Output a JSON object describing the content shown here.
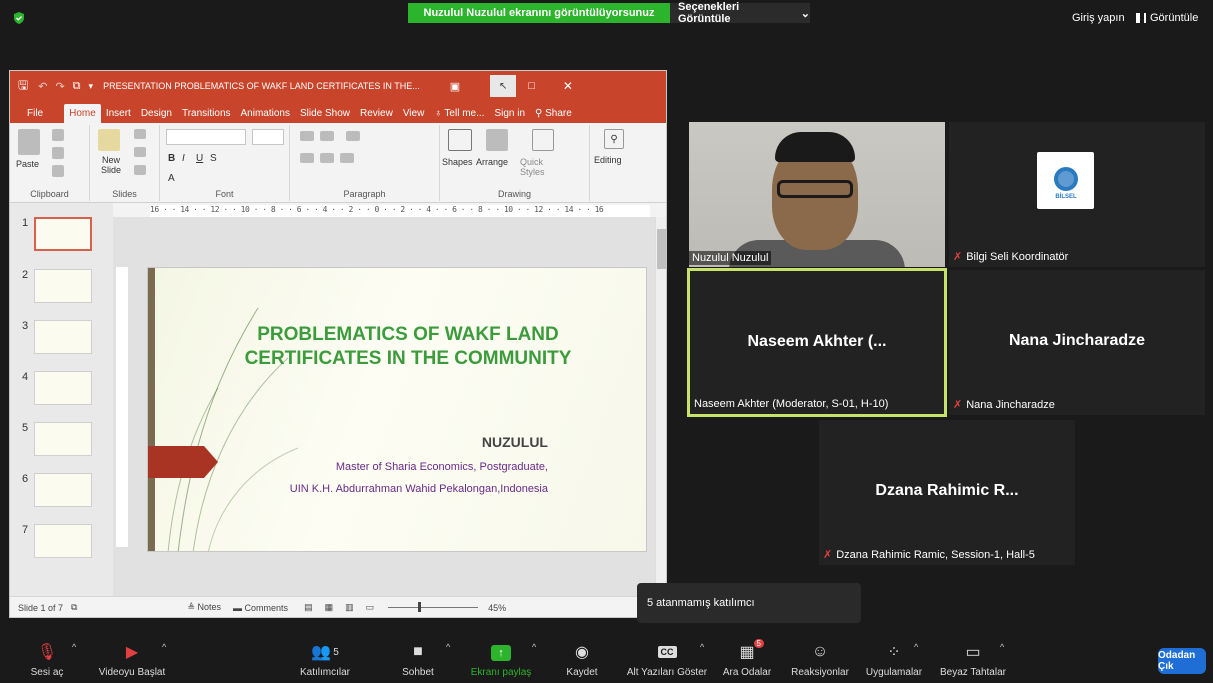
{
  "topbar": {
    "share_banner": "Nuzulul Nuzulul ekranını görüntülüyorsunuz",
    "view_options": "Seçenekleri Görüntüle",
    "sign_in": "Giriş yapın",
    "view": "Görüntüle"
  },
  "ppt": {
    "window_title": "PRESENTATION PROBLEMATICS OF WAKF LAND CERTIFICATES IN THE...",
    "tabs": [
      "File",
      "Home",
      "Insert",
      "Design",
      "Transitions",
      "Animations",
      "Slide Show",
      "Review",
      "View",
      "Tell me...",
      "Sign in",
      "Share"
    ],
    "ribbon": {
      "paste": "Paste",
      "new_slide": "New Slide",
      "shapes": "Shapes",
      "arrange": "Arrange",
      "quick_styles": "Quick Styles",
      "editing": "Editing",
      "groups": [
        "Clipboard",
        "Slides",
        "Font",
        "Paragraph",
        "Drawing"
      ]
    },
    "ruler_text": "16 · · 14 · · 12 · · 10 · · 8 · · 6 · · 4 · · 2 · · 0 · · 2 · · 4 · · 6 · · 8 · · 10 · · 12 · · 14 · · 16",
    "slide_numbers": [
      "1",
      "2",
      "3",
      "4",
      "5",
      "6",
      "7"
    ],
    "slide": {
      "title": "PROBLEMATICS OF WAKF LAND CERTIFICATES IN THE COMMUNITY",
      "author": "NUZULUL",
      "subtitle1": "Master of Sharia Economics, Postgraduate,",
      "subtitle2": "UIN K.H. Abdurrahman Wahid Pekalongan,Indonesia"
    },
    "status": {
      "slide_of": "Slide 1 of 7",
      "notes": "Notes",
      "comments": "Comments",
      "zoom": "45%"
    }
  },
  "participants": [
    {
      "name": "Nuzulul Nuzulul"
    },
    {
      "name": "Bilgi Seli Koordinatör"
    },
    {
      "big": "Naseem Akhter (...",
      "name": "Naseem Akhter (Moderator, S-01, H-10)"
    },
    {
      "big": "Nana Jincharadze",
      "name": "Nana Jincharadze"
    },
    {
      "big": "Dzana Rahimic R...",
      "name": "Dzana Rahimic Ramic, Session-1, Hall-5"
    }
  ],
  "logo_text": "BİLSEL",
  "tooltip": "5 atanmamış katılımcı",
  "toolbar": {
    "mute": "Sesi aç",
    "video": "Videoyu Başlat",
    "participants": "Katılımcılar",
    "participants_count": "5",
    "chat": "Sohbet",
    "share": "Ekranı paylaş",
    "record": "Kaydet",
    "captions": "Alt Yazıları Göster",
    "captions_icon": "CC",
    "breakout": "Ara Odalar",
    "breakout_badge": "5",
    "reactions": "Reaksiyonlar",
    "apps": "Uygulamalar",
    "whiteboard": "Beyaz Tahtalar",
    "leave": "Odadan Çık"
  },
  "colors": {
    "share_green": "#2cb42c",
    "ppt_red": "#c8452c",
    "active_speaker": "#c7e26a",
    "leave_blue": "#1e6ed6"
  }
}
